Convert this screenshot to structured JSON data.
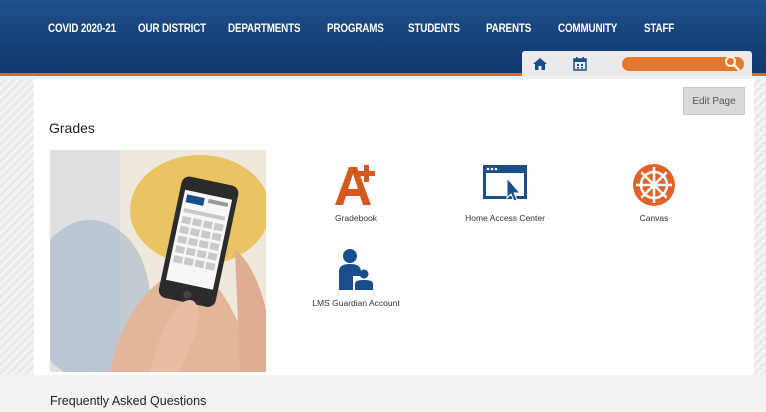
{
  "nav": {
    "items": [
      "COVID 2020-21",
      "OUR DISTRICT",
      "DEPARTMENTS",
      "PROGRAMS",
      "STUDENTS",
      "PARENTS",
      "COMMUNITY",
      "STAFF"
    ]
  },
  "utility": {
    "home_icon": "home-icon",
    "calendar_icon": "calendar-icon",
    "search_icon": "search-icon",
    "search_placeholder": ""
  },
  "page": {
    "edit_label": "Edit Page",
    "title": "Grades"
  },
  "tiles": [
    {
      "label": "Gradebook",
      "icon": "gradebook-a-plus-icon",
      "color": "#d35a1c"
    },
    {
      "label": "Home Access Center",
      "icon": "browser-cursor-icon",
      "color": "#1a4d8c"
    },
    {
      "label": "Canvas",
      "icon": "canvas-logo-icon",
      "color": "#e0622a"
    },
    {
      "label": "LMS Guardian Account",
      "icon": "guardian-user-icon",
      "color": "#1a4d8c"
    }
  ],
  "faq": {
    "heading": "Frequently Asked Questions"
  },
  "colors": {
    "nav_bg": "#10386b",
    "accent": "#d96a2a"
  }
}
